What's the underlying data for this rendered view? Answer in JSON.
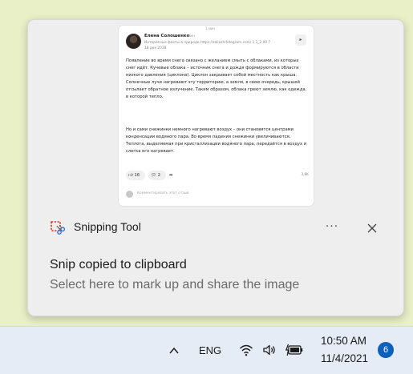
{
  "notification": {
    "app_name": "Snipping Tool",
    "more_icon": "ellipsis-icon",
    "close_icon": "close-icon",
    "heading": "Snip copied to clipboard",
    "subtext": "Select here to mark up and share the image",
    "preview": {
      "top_label": "1 мин",
      "author": "Елена Солошенко",
      "author_sub": "• 1 мин",
      "meta": "Интересные факты о природе  https://zakazhifotogram.com/ 1 1_2 00 7",
      "date": "18 дек 2018",
      "paragraph1": "Появление во время снега связано с желанием смыть с облаками, из которых снег идёт. Кучевые облака – источник снега и дождя формируются в области низкого давления (циклона). Циклон закрывает собой местность как крыша. Солнечные лучи нагревают эту территорию, а земля, в свою очередь, крышей отсылает обратное излучение. Таким образом, облака греют землю, как одежда, в которой тепло.",
      "paragraph2": "Но и сами снежинки немного нагревают воздух – они становятся центрами конденсации водяного пара. Во время падения снежинки увеличиваются. Теплота, выделяемая при кристаллизации водяного пара, передаётся в воздух и слегка его нагревает.",
      "likes": "16",
      "comments": "2",
      "views": "3,8K",
      "comment_placeholder": "Комментировать этот отзыв"
    }
  },
  "taskbar": {
    "chevron_icon": "chevron-up-icon",
    "language": "ENG",
    "wifi_icon": "wifi-icon",
    "volume_icon": "volume-icon",
    "battery_icon": "battery-charging-icon",
    "time": "10:50 AM",
    "date": "11/4/2021",
    "notification_count": "6"
  },
  "colors": {
    "desktop": "#e9efc7",
    "toast_bg": "#eeeeee",
    "taskbar_bg": "#e6ecf5",
    "badge": "#0b5fbd"
  }
}
